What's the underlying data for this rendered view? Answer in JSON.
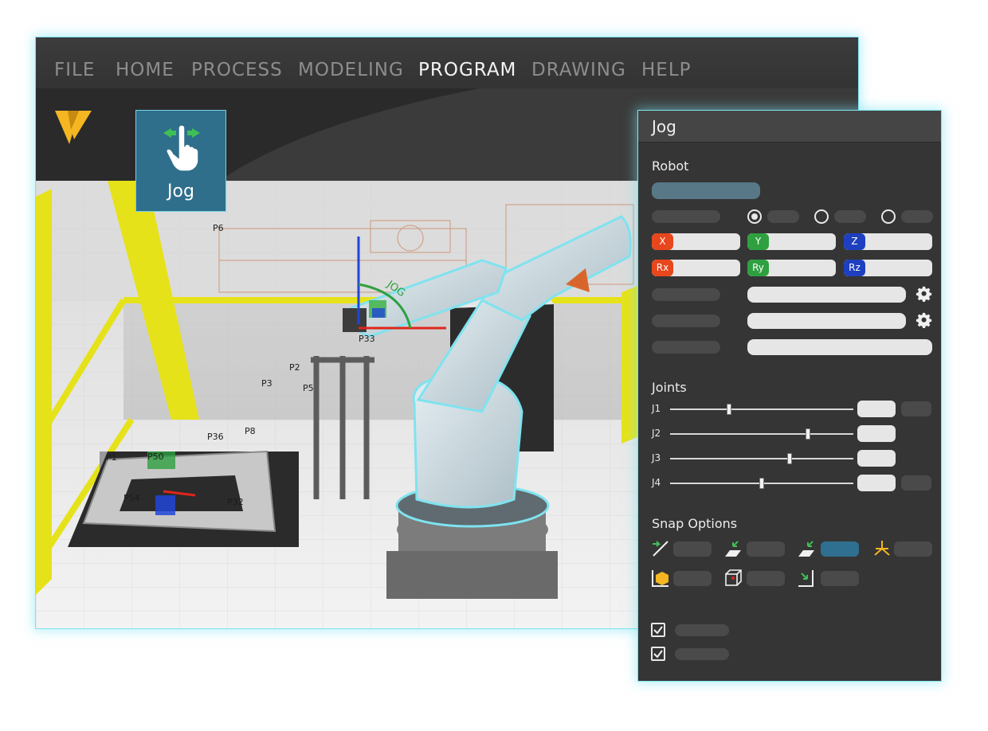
{
  "menu": {
    "items": [
      {
        "label": "FILE",
        "active": false
      },
      {
        "label": "HOME",
        "active": false
      },
      {
        "label": "PROCESS",
        "active": false
      },
      {
        "label": "MODELING",
        "active": false
      },
      {
        "label": "PROGRAM",
        "active": true
      },
      {
        "label": "DRAWING",
        "active": false
      },
      {
        "label": "HELP",
        "active": false
      }
    ]
  },
  "ribbon": {
    "logo_icon": "v-logo-icon",
    "jog_tool": {
      "label": "Jog",
      "icon": "hand-pointer-icon"
    }
  },
  "scene": {
    "point_labels": [
      "P6",
      "P2",
      "P3",
      "P5",
      "P1",
      "P8",
      "P32",
      "P33",
      "P36",
      "P50",
      "P54"
    ],
    "manipulator_label": "JOG"
  },
  "jog_panel": {
    "title": "Jog",
    "robot_section": {
      "title": "Robot",
      "axes": [
        {
          "label": "X",
          "color": "#e8461c"
        },
        {
          "label": "Y",
          "color": "#2ea040"
        },
        {
          "label": "Z",
          "color": "#1d3fc0"
        },
        {
          "label": "Rx",
          "color": "#e8461c"
        },
        {
          "label": "Ry",
          "color": "#2ea040"
        },
        {
          "label": "Rz",
          "color": "#1d3fc0"
        }
      ],
      "selected_radio": 0,
      "settings_icon": "gear-icon"
    },
    "joints_section": {
      "title": "Joints",
      "joints": [
        {
          "label": "J1",
          "position": 0.32
        },
        {
          "label": "J2",
          "position": 0.75
        },
        {
          "label": "J3",
          "position": 0.65
        },
        {
          "label": "J4",
          "position": 0.5
        }
      ]
    },
    "snap_section": {
      "title": "Snap Options",
      "options": [
        {
          "icon": "snap-edge-icon",
          "active": false
        },
        {
          "icon": "snap-face-icon",
          "active": false
        },
        {
          "icon": "snap-face-point-icon",
          "active": true
        },
        {
          "icon": "snap-axes-icon",
          "active": false
        },
        {
          "icon": "snap-box-icon",
          "active": false
        },
        {
          "icon": "snap-bounding-box-icon",
          "active": false
        },
        {
          "icon": "snap-corner-icon",
          "active": false
        }
      ]
    },
    "checkboxes": [
      {
        "checked": true
      },
      {
        "checked": true
      }
    ]
  },
  "colors": {
    "accent": "#2f7090",
    "highlight": "#7fe3ef",
    "brand": "#f5b622"
  }
}
